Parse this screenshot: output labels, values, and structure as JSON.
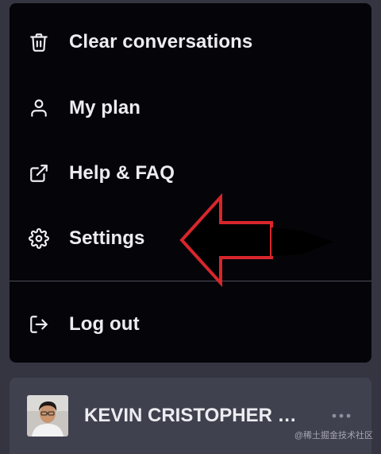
{
  "menu": {
    "items": [
      {
        "label": "Clear conversations",
        "icon": "trash-icon"
      },
      {
        "label": "My plan",
        "icon": "user-icon"
      },
      {
        "label": "Help & FAQ",
        "icon": "external-link-icon"
      },
      {
        "label": "Settings",
        "icon": "gear-icon"
      }
    ],
    "logout": {
      "label": "Log out",
      "icon": "logout-icon"
    }
  },
  "annotation": {
    "type": "arrow",
    "color": "#d8262c",
    "points_to": "Settings"
  },
  "user": {
    "name": "KEVIN CRISTOPHER G...",
    "more_icon": "ellipsis-icon"
  },
  "watermark": "@稀土掘金技术社区",
  "colors": {
    "menu_bg": "#050509",
    "page_bg": "#343541",
    "user_row_bg": "#40414f",
    "text": "#ececf1",
    "divider": "#4d4d58"
  }
}
